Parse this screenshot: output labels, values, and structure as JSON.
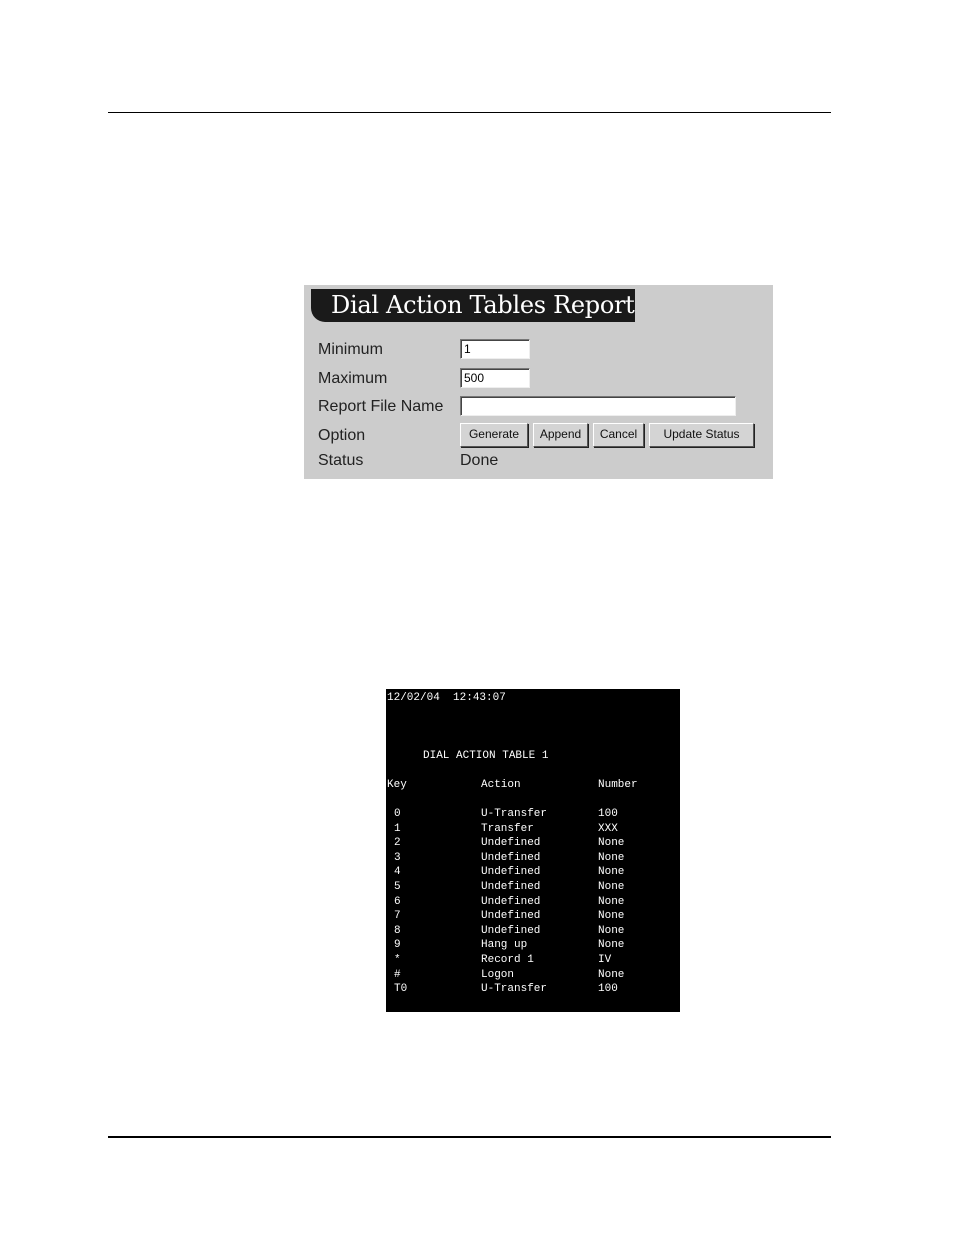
{
  "dialog": {
    "title": "Dial Action Tables Report",
    "fields": {
      "minimum": {
        "label": "Minimum",
        "value": "1"
      },
      "maximum": {
        "label": "Maximum",
        "value": "500"
      },
      "report_file_name": {
        "label": "Report File Name",
        "value": ""
      },
      "option": {
        "label": "Option"
      },
      "status": {
        "label": "Status",
        "value": "Done"
      }
    },
    "buttons": {
      "generate": "Generate",
      "append": "Append",
      "cancel": "Cancel",
      "update_status": "Update Status"
    }
  },
  "report": {
    "timestamp": "12/02/04  12:43:07",
    "title": "DIAL ACTION TABLE 1",
    "headers": {
      "key": "Key",
      "action": "Action",
      "number": "Number"
    },
    "rows": [
      {
        "key": "0",
        "action": "U-Transfer",
        "number": "100"
      },
      {
        "key": "1",
        "action": "Transfer",
        "number": "XXX"
      },
      {
        "key": "2",
        "action": "Undefined",
        "number": "None"
      },
      {
        "key": "3",
        "action": "Undefined",
        "number": "None"
      },
      {
        "key": "4",
        "action": "Undefined",
        "number": "None"
      },
      {
        "key": "5",
        "action": "Undefined",
        "number": "None"
      },
      {
        "key": "6",
        "action": "Undefined",
        "number": "None"
      },
      {
        "key": "7",
        "action": "Undefined",
        "number": "None"
      },
      {
        "key": "8",
        "action": "Undefined",
        "number": "None"
      },
      {
        "key": "9",
        "action": "Hang up",
        "number": "None"
      },
      {
        "key": "*",
        "action": "Record 1",
        "number": "IV"
      },
      {
        "key": "#",
        "action": "Logon",
        "number": "None"
      },
      {
        "key": "T0",
        "action": "U-Transfer",
        "number": "100"
      }
    ]
  }
}
